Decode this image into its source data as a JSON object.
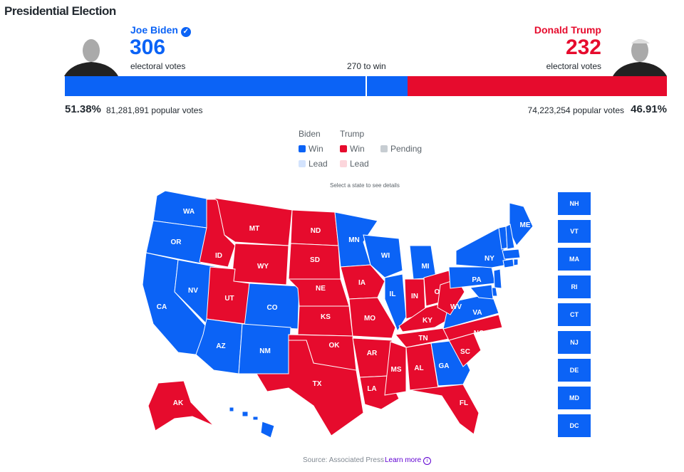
{
  "title": "Presidential Election",
  "colors": {
    "biden": "#0b63f6",
    "trump": "#e60b2d",
    "pending": "#c7cdd2"
  },
  "biden": {
    "name": "Joe Biden",
    "electoral_votes": "306",
    "ev_label": "electoral votes",
    "percent": "51.38%",
    "popular_votes": "81,281,891 popular votes",
    "verified_icon": "check-circle-icon"
  },
  "trump": {
    "name": "Donald Trump",
    "electoral_votes": "232",
    "ev_label": "electoral votes",
    "percent": "46.91%",
    "popular_votes": "74,223,254 popular votes"
  },
  "to_win": "270 to win",
  "legend": {
    "biden": "Biden",
    "trump": "Trump",
    "win": "Win",
    "lead": "Lead",
    "pending": "Pending"
  },
  "instruction": "Select a state to see details",
  "states": {
    "WA": "D",
    "OR": "D",
    "CA": "D",
    "NV": "D",
    "ID": "R",
    "MT": "R",
    "WY": "R",
    "UT": "R",
    "CO": "D",
    "AZ": "D",
    "NM": "D",
    "ND": "R",
    "SD": "R",
    "NE": "R",
    "KS": "R",
    "OK": "R",
    "TX": "R",
    "MN": "D",
    "IA": "R",
    "MO": "R",
    "AR": "R",
    "LA": "R",
    "WI": "D",
    "IL": "D",
    "MI": "D",
    "IN": "R",
    "OH": "R",
    "KY": "R",
    "TN": "R",
    "MS": "R",
    "AL": "R",
    "GA": "D",
    "FL": "R",
    "SC": "R",
    "NC": "R",
    "VA": "D",
    "WV": "R",
    "PA": "D",
    "NY": "D",
    "ME": "D",
    "VT": "D",
    "NH": "D",
    "MA": "D",
    "CT": "D",
    "NJ": "D",
    "DE": "D",
    "MD": "D",
    "RI": "D",
    "AK": "R",
    "HI": "D"
  },
  "small_states": [
    "NH",
    "VT",
    "MA",
    "RI",
    "CT",
    "NJ",
    "DE",
    "MD",
    "DC"
  ],
  "footer": {
    "source": "Source: Associated Press",
    "learn_more": "Learn more"
  }
}
